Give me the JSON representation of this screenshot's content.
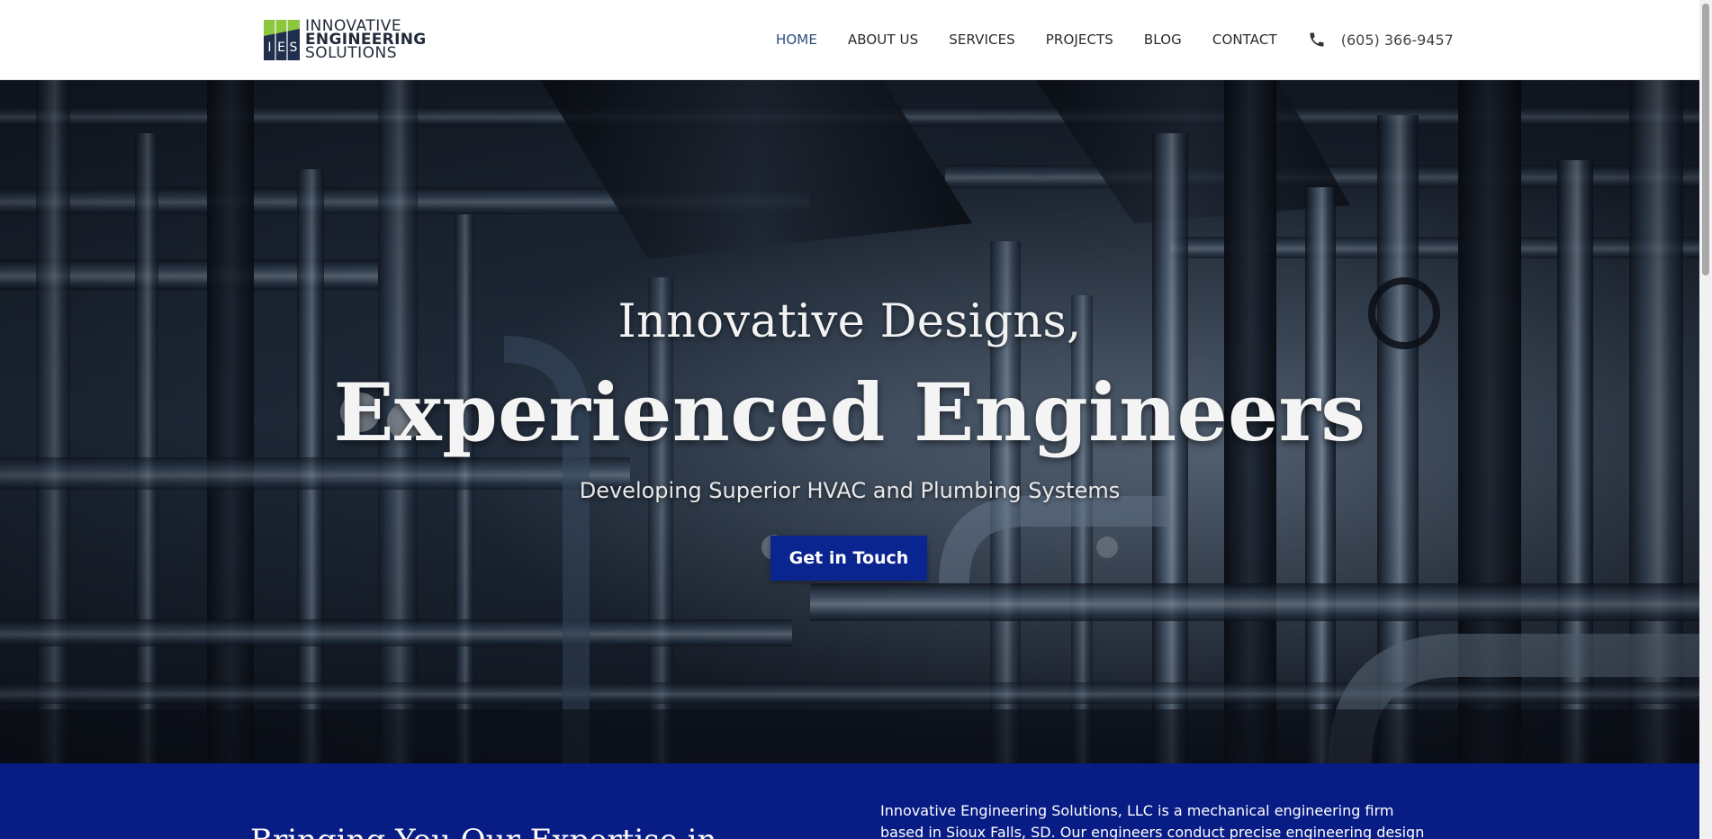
{
  "logo": {
    "mark_letters": "IES",
    "line1": "INNOVATIVE",
    "line2": "ENGINEERING",
    "line3": "SOLUTIONS"
  },
  "nav": {
    "items": [
      {
        "label": "HOME",
        "active": true
      },
      {
        "label": "ABOUT US",
        "active": false
      },
      {
        "label": "SERVICES",
        "active": false
      },
      {
        "label": "PROJECTS",
        "active": false
      },
      {
        "label": "BLOG",
        "active": false
      },
      {
        "label": "CONTACT",
        "active": false
      }
    ],
    "phone_icon": "phone-icon",
    "phone": "(605) 366-9457"
  },
  "hero": {
    "line1": "Innovative Designs,",
    "line2": "Experienced Engineers",
    "tagline": "Developing Superior HVAC and Plumbing Systems",
    "cta_label": "Get in Touch"
  },
  "intro": {
    "heading": "Bringing You Our Expertise in",
    "paragraph": "Innovative Engineering Solutions, LLC is a mechanical engineering firm based in Sioux Falls, SD. Our engineers conduct precise engineering design services for new"
  },
  "colors": {
    "brand_blue": "#071c85",
    "cta_blue": "#0b2590",
    "logo_green": "#8dc63f",
    "logo_navy": "#1f2f4d",
    "nav_active": "#2a4d7a"
  }
}
